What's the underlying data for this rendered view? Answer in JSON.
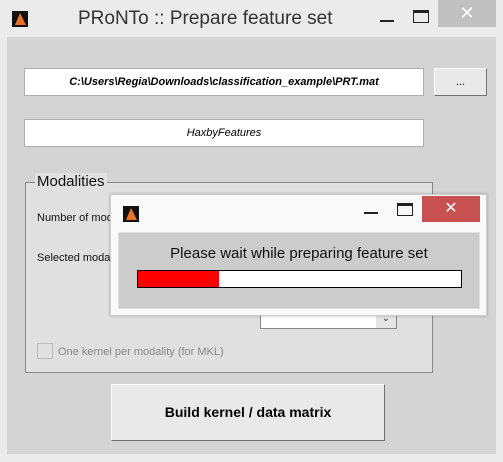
{
  "window": {
    "title": "PRoNTo :: Prepare feature set",
    "close_label": "✕"
  },
  "main": {
    "prt_path": "C:\\Users\\Regia\\Downloads\\classification_example\\PRT.mat",
    "browse_label": "...",
    "feature_set_name": "HaxbyFeatures",
    "modalities": {
      "legend": "Modalities",
      "number_label": "Number of mod",
      "selected_label": "Selected modal",
      "selected_value": "",
      "mkl_checkbox_label": "One kernel per modality (for MKL)",
      "mkl_checked": false
    },
    "build_label": "Build kernel / data matrix"
  },
  "progress_dialog": {
    "close_label": "✕",
    "message": "Please wait while preparing feature set",
    "progress": 0.25,
    "bar_color": "#ff0000"
  }
}
